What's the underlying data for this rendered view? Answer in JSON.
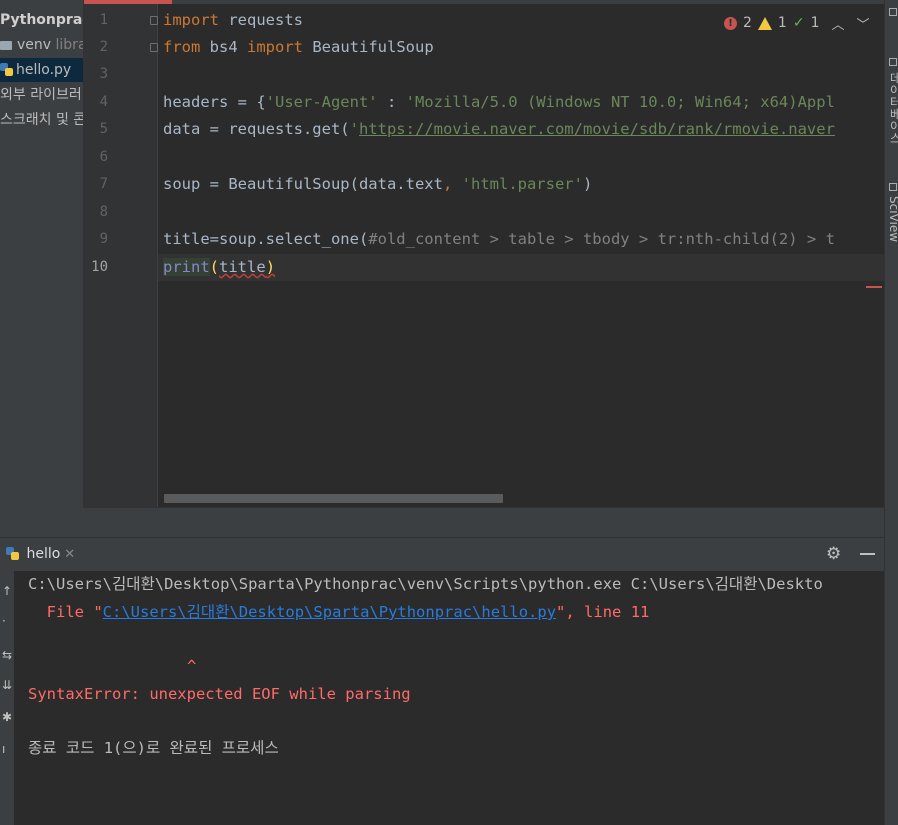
{
  "project_panel": {
    "root": "Pythonprac",
    "venv_name": "venv",
    "venv_note": "libra",
    "file": "hello.py",
    "external_libraries": "외부 라이브러",
    "scratches": "스크래치 및 콘"
  },
  "editor": {
    "line_numbers": [
      "1",
      "2",
      "3",
      "4",
      "5",
      "6",
      "7",
      "8",
      "9",
      "10"
    ],
    "lines": {
      "l1": {
        "kw": "import",
        "rest": " requests"
      },
      "l2": {
        "kw1": "from",
        "mid": " bs4 ",
        "kw2": "import",
        "rest": " BeautifulSoup"
      },
      "l4": {
        "pre": "headers = {",
        "s1": "'User-Agent'",
        "mid": " : ",
        "s2": "'Mozilla/5.0 (Windows NT 10.0; Win64; x64)Appl"
      },
      "l5": {
        "pre": "data = requests.get(",
        "q": "'",
        "url": "https://movie.naver.com/movie/sdb/rank/rmovie.naver"
      },
      "l7": {
        "pre": "soup = BeautifulSoup(data.text",
        "comma": ",",
        "sp": " ",
        "s": "'html.parser'",
        "post": ")"
      },
      "l9": {
        "pre": "title=soup.select_one(",
        "comment": "#old_content > table > tbody > tr:nth-child(2) > t"
      },
      "l10": {
        "fn": "print",
        "open": "(",
        "arg": "title",
        "close": ")"
      }
    }
  },
  "inspections": {
    "errors": "2",
    "warnings": "1",
    "weak_warnings": "1"
  },
  "right_strip": {
    "tool1": "데이터베이스",
    "tool2": "SciView"
  },
  "run_window": {
    "tab_label": "hello",
    "console": {
      "line1": "C:\\Users\\김대환\\Desktop\\Sparta\\Pythonprac\\venv\\Scripts\\python.exe C:\\Users\\김대환\\Deskto",
      "line2_pre": "  File \"",
      "line2_link": "C:\\Users\\김대환\\Desktop\\Sparta\\Pythonprac\\hello.py",
      "line2_post": "\", line 11",
      "caret": "^",
      "error": "SyntaxError: unexpected EOF while parsing",
      "exit": "종료 코드 1(으)로 완료된 프로세스"
    }
  },
  "colors": {
    "background": "#2b2b2b",
    "keyword": "#cc7832",
    "string": "#6a8759",
    "error": "#ff6b68",
    "link": "#287bde"
  }
}
